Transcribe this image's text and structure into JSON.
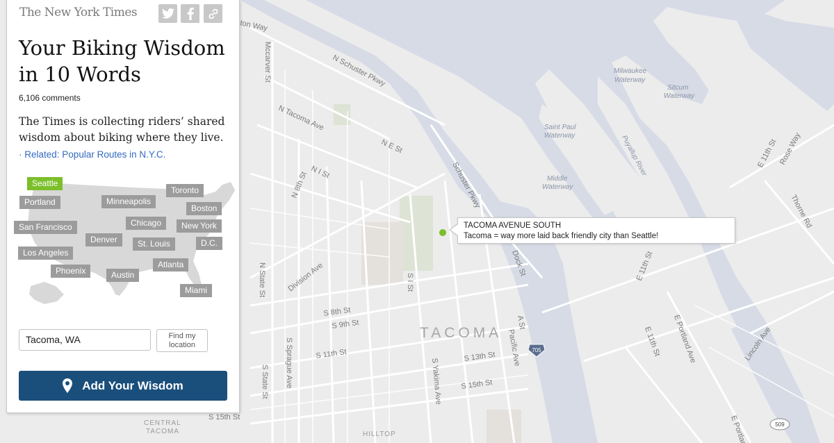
{
  "brand": {
    "logo_text": "The New York Times"
  },
  "share": {
    "twitter_icon": "twitter-icon",
    "facebook_icon": "facebook-icon",
    "link_icon": "link-icon"
  },
  "article": {
    "headline": "Your Biking Wisdom in 10 Words",
    "comments": "6,106 comments",
    "summary": "The Times is collecting riders’ shared wisdom about biking where they live.",
    "related_bullet": "·",
    "related": "Related: Popular Routes in N.Y.C."
  },
  "us_map": {
    "cities": [
      {
        "name": "Seattle",
        "active": true
      },
      {
        "name": "Toronto",
        "active": false
      },
      {
        "name": "Portland",
        "active": false
      },
      {
        "name": "Minneapolis",
        "active": false
      },
      {
        "name": "Boston",
        "active": false
      },
      {
        "name": "San Francisco",
        "active": false
      },
      {
        "name": "Chicago",
        "active": false
      },
      {
        "name": "New York",
        "active": false
      },
      {
        "name": "Denver",
        "active": false
      },
      {
        "name": "St. Louis",
        "active": false
      },
      {
        "name": "D.C.",
        "active": false
      },
      {
        "name": "Los Angeles",
        "active": false
      },
      {
        "name": "Atlanta",
        "active": false
      },
      {
        "name": "Phoenix",
        "active": false
      },
      {
        "name": "Austin",
        "active": false
      },
      {
        "name": "Miami",
        "active": false
      }
    ],
    "active_color": "#7cbf2a",
    "inactive_color": "#9c9c9c"
  },
  "location": {
    "value": "Tacoma, WA",
    "find_button": "Find my location"
  },
  "add_button": {
    "label": "Add Your Wisdom",
    "icon": "map-pin-icon",
    "color": "#1a4f7c"
  },
  "popup": {
    "title": "TACOMA AVENUE SOUTH",
    "comment": "Tacoma = way more laid back friendly city than Seattle!"
  },
  "map": {
    "city_label": "TACOMA",
    "district_labels": [
      "CENTRAL",
      "TACOMA",
      "HILLTOP"
    ],
    "water_labels": [
      "Milwaukee",
      "Waterway",
      "Sitcum",
      "Waterway",
      "Saint Paul",
      "Waterway",
      "Middle",
      "Waterway",
      "Puyallup River"
    ],
    "street_labels": [
      "ton Way",
      "Mccarver St",
      "N Schuster Pkwy",
      "N Tacoma Ave",
      "N E St",
      "N I St",
      "N 8th St",
      "Schuster Pkwy",
      "Division Ave",
      "N State St",
      "S I St",
      "S 8th St",
      "S 9th St",
      "S 11th St",
      "S Sprague Ave",
      "S State St",
      "S 15th St",
      "S Yakima Ave",
      "S 13th St",
      "S 15th St",
      "A St",
      "Pacific Ave",
      "Dock St",
      "E 11th St",
      "E 11th St",
      "Rose Way",
      "Thorne Rd",
      "E Portland Ave",
      "Lincoln Ave",
      "E 11th St",
      "E Portland Ave",
      "705",
      "509"
    ],
    "colors": {
      "land": "#ececec",
      "water": "#d6dbe6",
      "road": "#ffffff",
      "park": "#dde3d5"
    }
  }
}
